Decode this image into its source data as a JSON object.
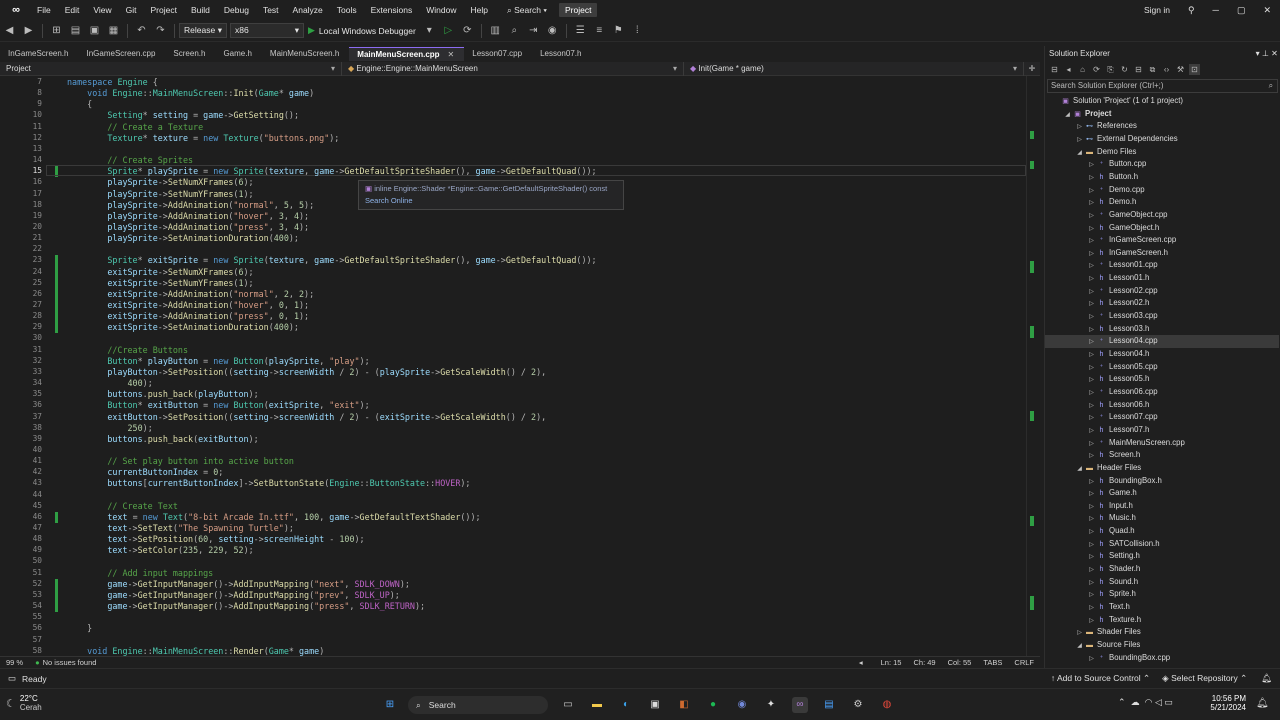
{
  "menu": {
    "items": [
      "File",
      "Edit",
      "View",
      "Git",
      "Project",
      "Build",
      "Debug",
      "Test",
      "Analyze",
      "Tools",
      "Extensions",
      "Window",
      "Help"
    ],
    "search_label": "Search",
    "project_name": "Project",
    "sign_in": "Sign in"
  },
  "toolbar": {
    "config": "Release",
    "platform": "x86",
    "debugger": "Local Windows Debugger"
  },
  "tabs": [
    {
      "label": "InGameScreen.h",
      "active": false
    },
    {
      "label": "InGameScreen.cpp",
      "active": false
    },
    {
      "label": "Screen.h",
      "active": false
    },
    {
      "label": "Game.h",
      "active": false
    },
    {
      "label": "MainMenuScreen.h",
      "active": false
    },
    {
      "label": "MainMenuScreen.cpp",
      "active": true
    },
    {
      "label": "Lesson07.cpp",
      "active": false
    },
    {
      "label": "Lesson07.h",
      "active": false
    }
  ],
  "tab_close_glyph": "✕",
  "navbar": {
    "scope": "Project",
    "class_scope": "Engine::Engine::MainMenuScreen",
    "member": "Init(Game * game)"
  },
  "editor": {
    "current_line": "15",
    "lines": [
      {
        "n": "7",
        "t": "namespace Engine {"
      },
      {
        "n": "8",
        "t": "    void Engine::MainMenuScreen::Init(Game* game)"
      },
      {
        "n": "9",
        "t": "    {"
      },
      {
        "n": "10",
        "t": "        Setting* setting = game->GetSetting();"
      },
      {
        "n": "11",
        "t": "        // Create a Texture"
      },
      {
        "n": "12",
        "t": "        Texture* texture = new Texture(\"buttons.png\");"
      },
      {
        "n": "13",
        "t": ""
      },
      {
        "n": "14",
        "t": "        // Create Sprites"
      },
      {
        "n": "15",
        "t": "        Sprite* playSprite = new Sprite(texture, game->GetDefaultSpriteShader(), game->GetDefaultQuad());"
      },
      {
        "n": "16",
        "t": "        playSprite->SetNumXFrames(6);"
      },
      {
        "n": "17",
        "t": "        playSprite->SetNumYFrames(1);"
      },
      {
        "n": "18",
        "t": "        playSprite->AddAnimation(\"normal\", 5, 5);"
      },
      {
        "n": "19",
        "t": "        playSprite->AddAnimation(\"hover\", 3, 4);"
      },
      {
        "n": "20",
        "t": "        playSprite->AddAnimation(\"press\", 3, 4);"
      },
      {
        "n": "21",
        "t": "        playSprite->SetAnimationDuration(400);"
      },
      {
        "n": "22",
        "t": ""
      },
      {
        "n": "23",
        "t": "        Sprite* exitSprite = new Sprite(texture, game->GetDefaultSpriteShader(), game->GetDefaultQuad());"
      },
      {
        "n": "24",
        "t": "        exitSprite->SetNumXFrames(6);"
      },
      {
        "n": "25",
        "t": "        exitSprite->SetNumYFrames(1);"
      },
      {
        "n": "26",
        "t": "        exitSprite->AddAnimation(\"normal\", 2, 2);"
      },
      {
        "n": "27",
        "t": "        exitSprite->AddAnimation(\"hover\", 0, 1);"
      },
      {
        "n": "28",
        "t": "        exitSprite->AddAnimation(\"press\", 0, 1);"
      },
      {
        "n": "29",
        "t": "        exitSprite->SetAnimationDuration(400);"
      },
      {
        "n": "30",
        "t": ""
      },
      {
        "n": "31",
        "t": "        //Create Buttons"
      },
      {
        "n": "32",
        "t": "        Button* playButton = new Button(playSprite, \"play\");"
      },
      {
        "n": "33",
        "t": "        playButton->SetPosition((setting->screenWidth / 2) - (playSprite->GetScaleWidth() / 2),"
      },
      {
        "n": "34",
        "t": "            400);"
      },
      {
        "n": "35",
        "t": "        buttons.push_back(playButton);"
      },
      {
        "n": "36",
        "t": "        Button* exitButton = new Button(exitSprite, \"exit\");"
      },
      {
        "n": "37",
        "t": "        exitButton->SetPosition((setting->screenWidth / 2) - (exitSprite->GetScaleWidth() / 2),"
      },
      {
        "n": "38",
        "t": "            250);"
      },
      {
        "n": "39",
        "t": "        buttons.push_back(exitButton);"
      },
      {
        "n": "40",
        "t": ""
      },
      {
        "n": "41",
        "t": "        // Set play button into active button"
      },
      {
        "n": "42",
        "t": "        currentButtonIndex = 0;"
      },
      {
        "n": "43",
        "t": "        buttons[currentButtonIndex]->SetButtonState(Engine::ButtonState::HOVER);"
      },
      {
        "n": "44",
        "t": ""
      },
      {
        "n": "45",
        "t": "        // Create Text"
      },
      {
        "n": "46",
        "t": "        text = new Text(\"8-bit Arcade In.ttf\", 100, game->GetDefaultTextShader());"
      },
      {
        "n": "47",
        "t": "        text->SetText(\"The Spawning Turtle\");"
      },
      {
        "n": "48",
        "t": "        text->SetPosition(60, setting->screenHeight - 100);"
      },
      {
        "n": "49",
        "t": "        text->SetColor(235, 229, 52);"
      },
      {
        "n": "50",
        "t": ""
      },
      {
        "n": "51",
        "t": "        // Add input mappings"
      },
      {
        "n": "52",
        "t": "        game->GetInputManager()->AddInputMapping(\"next\", SDLK_DOWN);"
      },
      {
        "n": "53",
        "t": "        game->GetInputManager()->AddInputMapping(\"prev\", SDLK_UP);"
      },
      {
        "n": "54",
        "t": "        game->GetInputManager()->AddInputMapping(\"press\", SDLK_RETURN);"
      },
      {
        "n": "55",
        "t": ""
      },
      {
        "n": "56",
        "t": "    }"
      },
      {
        "n": "57",
        "t": ""
      },
      {
        "n": "58",
        "t": "    void Engine::MainMenuScreen::Render(Game* game)"
      }
    ]
  },
  "tooltip": {
    "signature": "inline Engine::Shader *Engine::Game::GetDefaultSpriteShader() const",
    "link": "Search Online"
  },
  "editor_status": {
    "zoom": "99 %",
    "issues": "No issues found",
    "line": "Ln: 15",
    "col": "Ch: 49",
    "colnum": "Col: 55",
    "tabs": "TABS",
    "eol": "CRLF"
  },
  "solution_explorer": {
    "title": "Solution Explorer",
    "search_placeholder": "Search Solution Explorer (Ctrl+;)",
    "items": [
      {
        "label": "Solution 'Project' (1 of 1 project)",
        "depth": 0,
        "kind": "sln",
        "exp": ""
      },
      {
        "label": "Project",
        "depth": 1,
        "kind": "proj",
        "exp": "◢",
        "bold": true
      },
      {
        "label": "References",
        "depth": 2,
        "kind": "ref",
        "exp": "▷"
      },
      {
        "label": "External Dependencies",
        "depth": 2,
        "kind": "ref",
        "exp": "▷"
      },
      {
        "label": "Demo Files",
        "depth": 2,
        "kind": "folder",
        "exp": "◢"
      },
      {
        "label": "Button.cpp",
        "depth": 3,
        "kind": "cpp",
        "exp": "▷"
      },
      {
        "label": "Button.h",
        "depth": 3,
        "kind": "hfile",
        "exp": "▷"
      },
      {
        "label": "Demo.cpp",
        "depth": 3,
        "kind": "cpp",
        "exp": "▷"
      },
      {
        "label": "Demo.h",
        "depth": 3,
        "kind": "hfile",
        "exp": "▷"
      },
      {
        "label": "GameObject.cpp",
        "depth": 3,
        "kind": "cpp",
        "exp": "▷"
      },
      {
        "label": "GameObject.h",
        "depth": 3,
        "kind": "hfile",
        "exp": "▷"
      },
      {
        "label": "InGameScreen.cpp",
        "depth": 3,
        "kind": "cpp",
        "exp": "▷"
      },
      {
        "label": "InGameScreen.h",
        "depth": 3,
        "kind": "hfile",
        "exp": "▷"
      },
      {
        "label": "Lesson01.cpp",
        "depth": 3,
        "kind": "cpp",
        "exp": "▷"
      },
      {
        "label": "Lesson01.h",
        "depth": 3,
        "kind": "hfile",
        "exp": "▷"
      },
      {
        "label": "Lesson02.cpp",
        "depth": 3,
        "kind": "cpp",
        "exp": "▷"
      },
      {
        "label": "Lesson02.h",
        "depth": 3,
        "kind": "hfile",
        "exp": "▷"
      },
      {
        "label": "Lesson03.cpp",
        "depth": 3,
        "kind": "cpp",
        "exp": "▷"
      },
      {
        "label": "Lesson03.h",
        "depth": 3,
        "kind": "hfile",
        "exp": "▷"
      },
      {
        "label": "Lesson04.cpp",
        "depth": 3,
        "kind": "cpp",
        "exp": "▷",
        "sel": true
      },
      {
        "label": "Lesson04.h",
        "depth": 3,
        "kind": "hfile",
        "exp": "▷"
      },
      {
        "label": "Lesson05.cpp",
        "depth": 3,
        "kind": "cpp",
        "exp": "▷"
      },
      {
        "label": "Lesson05.h",
        "depth": 3,
        "kind": "hfile",
        "exp": "▷"
      },
      {
        "label": "Lesson06.cpp",
        "depth": 3,
        "kind": "cpp",
        "exp": "▷"
      },
      {
        "label": "Lesson06.h",
        "depth": 3,
        "kind": "hfile",
        "exp": "▷"
      },
      {
        "label": "Lesson07.cpp",
        "depth": 3,
        "kind": "cpp",
        "exp": "▷"
      },
      {
        "label": "Lesson07.h",
        "depth": 3,
        "kind": "hfile",
        "exp": "▷"
      },
      {
        "label": "MainMenuScreen.cpp",
        "depth": 3,
        "kind": "cpp",
        "exp": "▷"
      },
      {
        "label": "Screen.h",
        "depth": 3,
        "kind": "hfile",
        "exp": "▷"
      },
      {
        "label": "Header Files",
        "depth": 2,
        "kind": "folder",
        "exp": "◢"
      },
      {
        "label": "BoundingBox.h",
        "depth": 3,
        "kind": "hfile",
        "exp": "▷"
      },
      {
        "label": "Game.h",
        "depth": 3,
        "kind": "hfile",
        "exp": "▷"
      },
      {
        "label": "Input.h",
        "depth": 3,
        "kind": "hfile",
        "exp": "▷"
      },
      {
        "label": "Music.h",
        "depth": 3,
        "kind": "hfile",
        "exp": "▷"
      },
      {
        "label": "Quad.h",
        "depth": 3,
        "kind": "hfile",
        "exp": "▷"
      },
      {
        "label": "SATCollision.h",
        "depth": 3,
        "kind": "hfile",
        "exp": "▷"
      },
      {
        "label": "Setting.h",
        "depth": 3,
        "kind": "hfile",
        "exp": "▷"
      },
      {
        "label": "Shader.h",
        "depth": 3,
        "kind": "hfile",
        "exp": "▷"
      },
      {
        "label": "Sound.h",
        "depth": 3,
        "kind": "hfile",
        "exp": "▷"
      },
      {
        "label": "Sprite.h",
        "depth": 3,
        "kind": "hfile",
        "exp": "▷"
      },
      {
        "label": "Text.h",
        "depth": 3,
        "kind": "hfile",
        "exp": "▷"
      },
      {
        "label": "Texture.h",
        "depth": 3,
        "kind": "hfile",
        "exp": "▷"
      },
      {
        "label": "Shader Files",
        "depth": 2,
        "kind": "folder",
        "exp": "▷"
      },
      {
        "label": "Source Files",
        "depth": 2,
        "kind": "folder",
        "exp": "◢"
      },
      {
        "label": "BoundingBox.cpp",
        "depth": 3,
        "kind": "cpp",
        "exp": "▷"
      }
    ]
  },
  "statusbar": {
    "ready": "Ready",
    "source_control": "Add to Source Control",
    "repository": "Select Repository"
  },
  "taskbar": {
    "temperature": "22°C",
    "weather": "Cerah",
    "search_label": "Search",
    "time": "10:56 PM",
    "date": "5/21/2024"
  },
  "colors": {
    "accent": "#8c6cf2",
    "change_marker": "#2f9e44"
  }
}
